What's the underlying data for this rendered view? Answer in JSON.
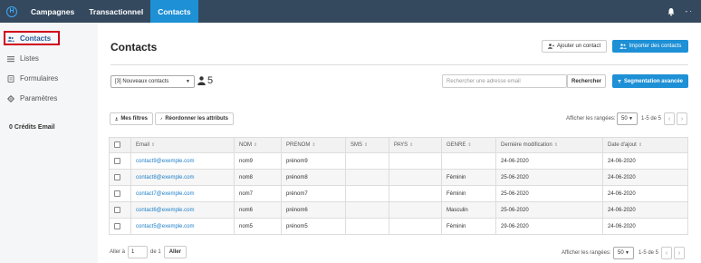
{
  "topnav": {
    "logo_glyph": "H",
    "items": [
      {
        "label": "Campagnes"
      },
      {
        "label": "Transactionnel"
      },
      {
        "label": "Contacts"
      }
    ],
    "user_label": "- ·"
  },
  "sidebar": {
    "items": [
      {
        "label": "Contacts",
        "icon": "users-icon"
      },
      {
        "label": "Listes",
        "icon": "list-icon"
      },
      {
        "label": "Formulaires",
        "icon": "form-icon"
      },
      {
        "label": "Paramètres",
        "icon": "gear-icon"
      }
    ],
    "credits": "0 Crédits Email"
  },
  "header": {
    "title": "Contacts",
    "add_contact": "Ajouter un contact",
    "import_contacts": "Importer des contacts"
  },
  "filters": {
    "list_select": "[3] Nouveaux contacts",
    "count": "5",
    "search_placeholder": "Rechercher une adresse email",
    "search_button": "Rechercher",
    "segmentation_button": "Segmentation avancée",
    "my_filters": "Mes filtres",
    "reorder": "Réordonner les attributs"
  },
  "pagination": {
    "show_label": "Afficher les rangées:",
    "page_size": "50",
    "range": "1-5 de 5",
    "goto_label": "Aller à",
    "goto_value": "1",
    "of_pages": "de 1",
    "goto_button": "Aller"
  },
  "table": {
    "columns": [
      "Email",
      "NOM",
      "PRENOM",
      "SMS",
      "PAYS",
      "GENRE",
      "Dernière modification",
      "Date d'ajout"
    ],
    "rows": [
      {
        "email": "contact9@exemple.com",
        "nom": "nom9",
        "prenom": "prénom9",
        "sms": "",
        "pays": "",
        "genre": "",
        "modif": "24-06-2020",
        "ajout": "24-06-2020"
      },
      {
        "email": "contact8@exemple.com",
        "nom": "nom8",
        "prenom": "prénom8",
        "sms": "",
        "pays": "",
        "genre": "Féminin",
        "modif": "25-06-2020",
        "ajout": "24-06-2020"
      },
      {
        "email": "contact7@exemple.com",
        "nom": "nom7",
        "prenom": "prénom7",
        "sms": "",
        "pays": "",
        "genre": "Féminin",
        "modif": "25-06-2020",
        "ajout": "24-06-2020"
      },
      {
        "email": "contact6@exemple.com",
        "nom": "nom6",
        "prenom": "prénom6",
        "sms": "",
        "pays": "",
        "genre": "Masculin",
        "modif": "25-06-2020",
        "ajout": "24-06-2020"
      },
      {
        "email": "contact5@exemple.com",
        "nom": "nom5",
        "prenom": "prénom5",
        "sms": "",
        "pays": "",
        "genre": "Féminin",
        "modif": "29-06-2020",
        "ajout": "24-06-2020"
      }
    ]
  },
  "colors": {
    "nav_bg": "#34495e",
    "accent": "#1e90d6",
    "highlight": "#d0021b",
    "link": "#1e7fc8"
  }
}
